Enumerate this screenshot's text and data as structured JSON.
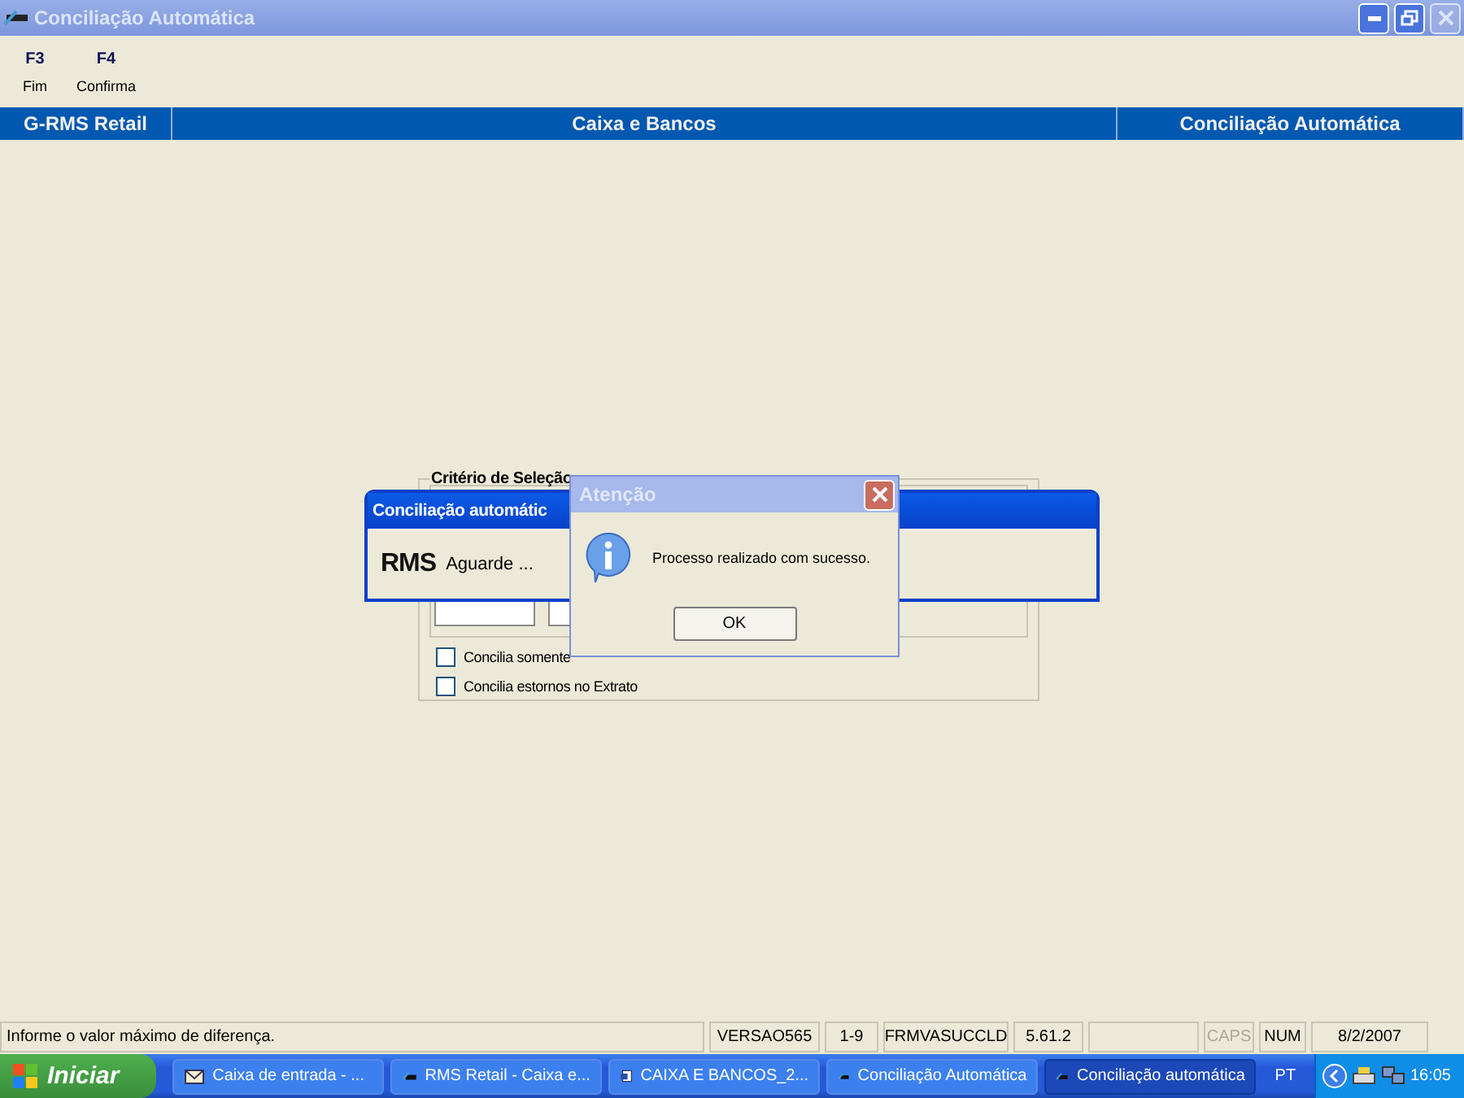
{
  "window": {
    "title": "Conciliação Automática",
    "buttons": [
      {
        "kind": "minimize",
        "disabled": false
      },
      {
        "kind": "restore",
        "disabled": false
      },
      {
        "kind": "close",
        "disabled": true
      }
    ]
  },
  "toolbar": [
    {
      "key": "F3",
      "label": "Fim"
    },
    {
      "key": "F4",
      "label": "Confirma"
    }
  ],
  "header": {
    "left": "G-RMS Retail",
    "center": "Caixa e Bancos",
    "right": "Conciliação Automática"
  },
  "group": {
    "title": "Critério de Seleção",
    "checkboxes": [
      {
        "label": "Concilia somente",
        "checked": false
      },
      {
        "label": "Concilia estornos no Extrato",
        "checked": false
      }
    ]
  },
  "progress_window": {
    "title": "Conciliação automátic",
    "logo": "RMS",
    "message": "Aguarde ..."
  },
  "dialog": {
    "title": "Atenção",
    "message": "Processo realizado com sucesso.",
    "button": "OK"
  },
  "status_bar": {
    "message": "Informe o valor máximo de diferença.",
    "cells": [
      "VERSAO565",
      "1-9",
      "FRMVASUCCLD",
      "5.61.2"
    ],
    "indicators": [
      {
        "text": "CAPS",
        "on": false
      },
      {
        "text": "NUM",
        "on": true
      }
    ],
    "date": "8/2/2007"
  },
  "taskbar": {
    "start": "Iniciar",
    "tasks": [
      {
        "label": "Caixa de entrada - ...",
        "kind": "mail",
        "selected": false
      },
      {
        "label": "RMS Retail - Caixa e...",
        "kind": "app",
        "selected": false
      },
      {
        "label": "CAIXA E BANCOS_2...",
        "kind": "word",
        "selected": false
      },
      {
        "label": "Conciliação Automática",
        "kind": "app",
        "selected": false
      },
      {
        "label": "Conciliação automática",
        "kind": "app",
        "selected": true
      }
    ],
    "language": "PT",
    "clock": "16:05"
  }
}
